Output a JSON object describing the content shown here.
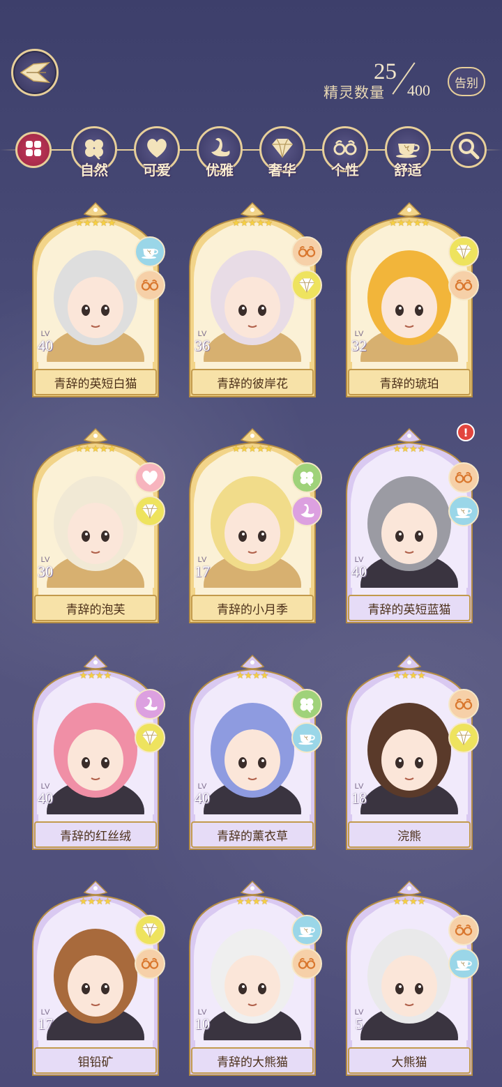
{
  "header": {
    "count_label": "精灵数量",
    "count_current": "25",
    "count_total": "400",
    "farewell_label": "告别"
  },
  "filters": [
    {
      "label": "",
      "icon": "grid-icon",
      "active": true
    },
    {
      "label": "自然",
      "icon": "clover-icon"
    },
    {
      "label": "可爱",
      "icon": "heart-icon"
    },
    {
      "label": "优雅",
      "icon": "swan-icon"
    },
    {
      "label": "奢华",
      "icon": "diamond-icon"
    },
    {
      "label": "个性",
      "icon": "glasses-icon"
    },
    {
      "label": "舒适",
      "icon": "teacup-icon"
    },
    {
      "label": "",
      "icon": "search-icon"
    }
  ],
  "cards": [
    {
      "name": "青辞的英短白猫",
      "lv": "40",
      "stars": "★★★★★",
      "frame": "gold",
      "tags": [
        "teacup-icon",
        "glasses-icon"
      ],
      "hair": "#dedede",
      "alert": false
    },
    {
      "name": "青辞的彼岸花",
      "lv": "36",
      "stars": "★★★★★",
      "frame": "gold",
      "tags": [
        "glasses-icon",
        "diamond-icon"
      ],
      "hair": "#e8dce6",
      "alert": false
    },
    {
      "name": "青辞的琥珀",
      "lv": "32",
      "stars": "★★★★★",
      "frame": "gold",
      "tags": [
        "diamond-icon",
        "glasses-icon"
      ],
      "hair": "#f2b53a",
      "alert": false
    },
    {
      "name": "青辞的泡芙",
      "lv": "30",
      "stars": "★★★★★",
      "frame": "gold",
      "tags": [
        "heart-icon",
        "diamond-icon"
      ],
      "hair": "#f1e9d5",
      "alert": false
    },
    {
      "name": "青辞的小月季",
      "lv": "17",
      "stars": "★★★★★",
      "frame": "gold",
      "tags": [
        "clover-icon",
        "swan-icon"
      ],
      "hair": "#f1dc8a",
      "alert": false
    },
    {
      "name": "青辞的英短蓝猫",
      "lv": "40",
      "stars": "★★★★",
      "frame": "purple",
      "tags": [
        "glasses-icon",
        "teacup-icon"
      ],
      "hair": "#9b9ba3",
      "alert": true
    },
    {
      "name": "青辞的红丝绒",
      "lv": "40",
      "stars": "★★★★",
      "frame": "purple",
      "tags": [
        "swan-icon",
        "diamond-icon"
      ],
      "hair": "#f08fa6",
      "alert": false
    },
    {
      "name": "青辞的薰衣草",
      "lv": "40",
      "stars": "★★★★",
      "frame": "purple",
      "tags": [
        "clover-icon",
        "teacup-icon"
      ],
      "hair": "#8e9be0",
      "alert": false
    },
    {
      "name": "浣熊",
      "lv": "18",
      "stars": "★★★★",
      "frame": "purple",
      "tags": [
        "glasses-icon",
        "diamond-icon"
      ],
      "hair": "#5a3a2a",
      "alert": false
    },
    {
      "name": "钼铅矿",
      "lv": "17",
      "stars": "★★★★",
      "frame": "purple",
      "tags": [
        "diamond-icon",
        "glasses-icon"
      ],
      "hair": "#a86a3c",
      "alert": false
    },
    {
      "name": "青辞的大熊猫",
      "lv": "10",
      "stars": "★★★★",
      "frame": "purple",
      "tags": [
        "teacup-icon",
        "glasses-icon"
      ],
      "hair": "#efefef",
      "alert": false
    },
    {
      "name": "大熊猫",
      "lv": "5",
      "stars": "★★★★",
      "frame": "purple",
      "tags": [
        "glasses-icon",
        "teacup-icon"
      ],
      "hair": "#e9e9ea",
      "alert": false
    }
  ],
  "colors": {
    "gold_frame": "#f2d489",
    "gold_inner": "#fbf1d6",
    "purple_frame": "#d9c9f1",
    "purple_inner": "#f1eafb",
    "gold_plate": "#f7e2a8",
    "purple_plate": "#e6dcf7"
  }
}
